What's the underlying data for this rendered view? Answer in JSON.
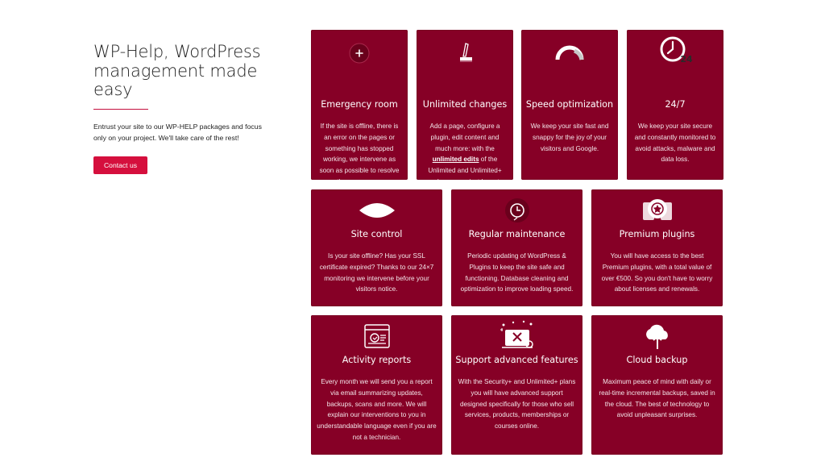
{
  "hero": {
    "title": "WP-Help, WordPress management made easy",
    "description": "Entrust your site to our WP-HELP packages and focus only on your project. We'll take care of the rest!",
    "cta_label": "Contact us"
  },
  "colors": {
    "card_background": "#860026",
    "accent": "#d50f3d",
    "text_on_card": "#ffffff"
  },
  "cards": [
    {
      "icon": "plus-circle-icon",
      "title": "Emergency room",
      "text": "If the site is offline, there is an error on the pages or something has stopped working, we intervene as soon as possible to resolve the emergency."
    },
    {
      "icon": "brush-icon",
      "title": "Unlimited changes",
      "text_before": "Add a page, configure a plugin, edit content and much more: with the",
      "text_bold": "unlimited edits",
      "text_after": "of the Unlimited and Unlimited+ packages you just have to ask!"
    },
    {
      "icon": "speedometer-icon",
      "title": "Speed optimization",
      "text": "We keep your site fast and snappy for the joy of your visitors and Google."
    },
    {
      "icon": "clock-24-icon",
      "title": "24/7",
      "icon_text": "24",
      "text": "We keep your site secure and constantly monitored to avoid attacks, malware and data loss."
    },
    {
      "icon": "eye-shape-icon",
      "title": "Site control",
      "text": "Is your site offline? Has your SSL certificate expired? Thanks to our 24×7 monitoring we intervene before your visitors notice."
    },
    {
      "icon": "maintenance-clock-icon",
      "title": "Regular maintenance",
      "text": "Periodic updating of WordPress & Plugins to keep the site safe and functioning. Database cleaning and optimization to improve loading speed."
    },
    {
      "icon": "premium-badge-icon",
      "title": "Premium plugins",
      "text": "You will have access to the best Premium plugins, with a total value of over €500. So you don't have to worry about licenses and renewals."
    },
    {
      "icon": "report-window-icon",
      "title": "Activity reports",
      "text": "Every month we will send you a report via email summarizing updates, backups, scans and more. We will explain our interventions to you in understandable language even if you are not a technician."
    },
    {
      "icon": "support-tools-icon",
      "title": "Support advanced features",
      "text": "With the Security+ and Unlimited+ plans you will have advanced support designed specifically for those who sell services, products, memberships or courses online."
    },
    {
      "icon": "cloud-upload-icon",
      "title": "Cloud backup",
      "text": "Maximum peace of mind with daily or real-time incremental backups, saved in the cloud. The best of technology to avoid unpleasant surprises."
    }
  ]
}
